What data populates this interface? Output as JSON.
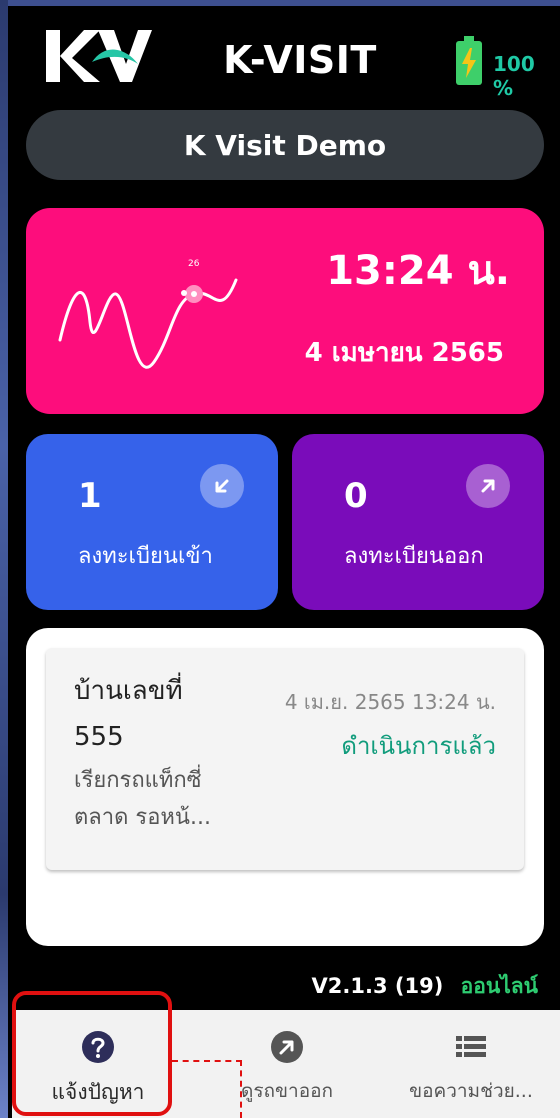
{
  "header": {
    "app_title": "K-VISIT",
    "battery_text": "100 %",
    "logo_text": "KV"
  },
  "user": {
    "name": "K Visit Demo"
  },
  "time_card": {
    "time": "13:24 น.",
    "date": "4 เมษายน 2565",
    "wave_marker": "26"
  },
  "stats": {
    "checkin": {
      "count": "1",
      "label": "ลงทะเบียนเข้า"
    },
    "checkout": {
      "count": "0",
      "label": "ลงทะเบียนออก"
    }
  },
  "entries": [
    {
      "house": "บ้านเลขที่ 555",
      "house_line1": "บ้านเลขที่",
      "house_line2": "555",
      "detail_line1": "เรียกรถแท็กซี่",
      "detail_line2": "ตลาด รอหน้...",
      "timestamp": "4 เม.ย. 2565 13:24 น.",
      "status": "ดำเนินการแล้ว"
    }
  ],
  "footer": {
    "version": "V2.1.3 (19)",
    "connection": "ออนไลน์"
  },
  "nav": {
    "items": [
      {
        "label": "แจ้งปัญหา",
        "icon": "question-circle-icon",
        "active": true
      },
      {
        "label": "ดูรถขาออก",
        "icon": "arrow-up-right-circle-icon",
        "active": false
      },
      {
        "label": "ขอความช่วย...",
        "icon": "list-icon",
        "active": false
      }
    ]
  },
  "colors": {
    "time_card": "#fd0d7c",
    "checkin_card": "#3662ea",
    "checkout_card": "#7a0cba",
    "status_done": "#119c7c",
    "online": "#2ecc71",
    "highlight": "#e01010"
  }
}
